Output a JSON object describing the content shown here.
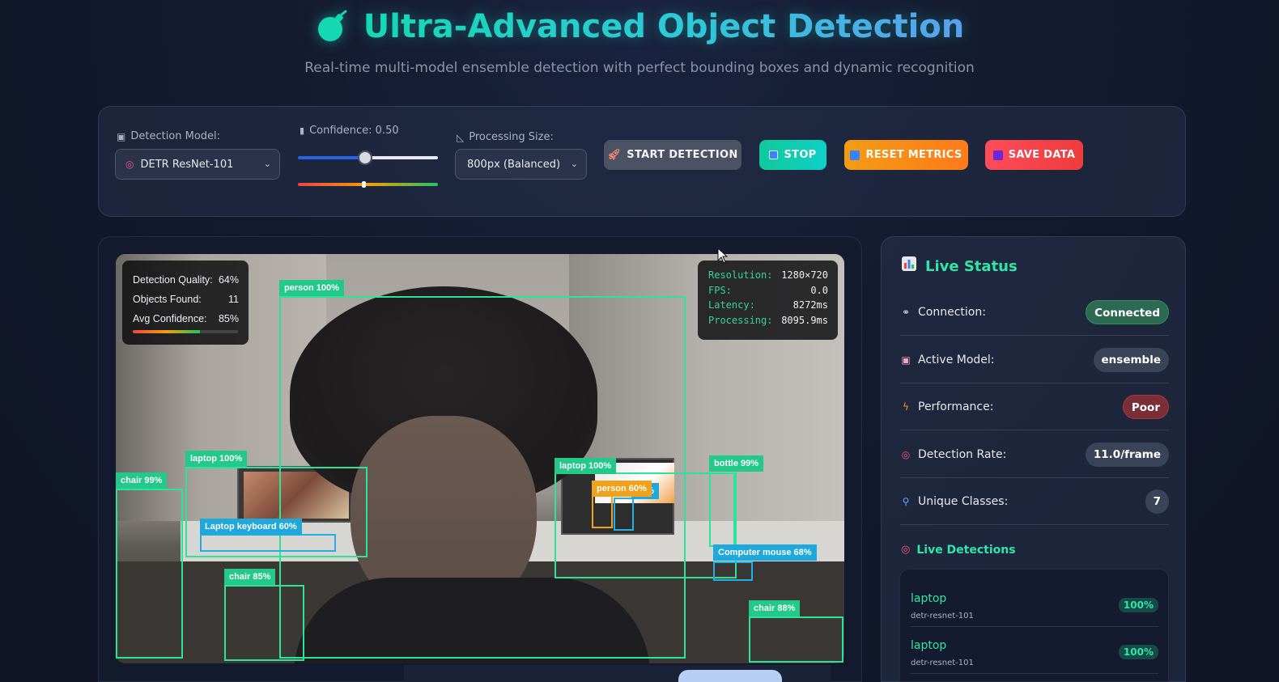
{
  "header": {
    "title": "Ultra-Advanced Object Detection",
    "subtitle": "Real-time multi-model ensemble detection with perfect bounding boxes and dynamic recognition"
  },
  "controls": {
    "model_label": "Detection Model:",
    "model_value": "DETR ResNet-101",
    "confidence_label": "Confidence: 0.50",
    "confidence_value": 0.5,
    "processing_label": "Processing Size:",
    "processing_value": "800px (Balanced)",
    "start_label": "START DETECTION",
    "stop_label": "STOP",
    "reset_label": "RESET METRICS",
    "save_label": "SAVE DATA"
  },
  "overlay_left": {
    "quality_label": "Detection Quality:",
    "quality_value": "64%",
    "quality_fraction": 0.64,
    "objects_label": "Objects Found:",
    "objects_value": "11",
    "avg_label": "Avg Confidence:",
    "avg_value": "85%"
  },
  "overlay_right": {
    "resolution_label": "Resolution:",
    "resolution_value": "1280×720",
    "fps_label": "FPS:",
    "fps_value": "0.0",
    "latency_label": "Latency:",
    "latency_value": "8272ms",
    "processing_label": "Processing:",
    "processing_value": "8095.9ms"
  },
  "detections_boxes": [
    {
      "label": "person 100%",
      "color": "green"
    },
    {
      "label": "laptop 100%",
      "color": "green"
    },
    {
      "label": "laptop 100%",
      "color": "green"
    },
    {
      "label": "chair 99%",
      "color": "green"
    },
    {
      "label": "bottle 99%",
      "color": "green"
    },
    {
      "label": "chair 85%",
      "color": "green"
    },
    {
      "label": "chair 88%",
      "color": "green"
    },
    {
      "label": "Laptop keyboard 60%",
      "color": "blue"
    },
    {
      "label": "Computer mouse 68%",
      "color": "blue"
    },
    {
      "label": "person 60%",
      "color": "orange"
    },
    {
      "label": "78%",
      "color": "blue"
    }
  ],
  "status": {
    "title": "Live Status",
    "rows": [
      {
        "label": "Connection:",
        "value": "Connected"
      },
      {
        "label": "Active Model:",
        "value": "ensemble"
      },
      {
        "label": "Performance:",
        "value": "Poor"
      },
      {
        "label": "Detection Rate:",
        "value": "11.0/frame"
      },
      {
        "label": "Unique Classes:",
        "value": "7"
      }
    ],
    "live_title": "Live Detections",
    "live_items": [
      {
        "name": "laptop",
        "model": "detr-resnet-101",
        "conf": "100%"
      },
      {
        "name": "laptop",
        "model": "detr-resnet-101",
        "conf": "100%"
      }
    ]
  },
  "colors": {
    "accent": "#2ee6a8",
    "box_green": "#2de39c",
    "box_blue": "#22aee6",
    "box_orange": "#f3a11b"
  }
}
